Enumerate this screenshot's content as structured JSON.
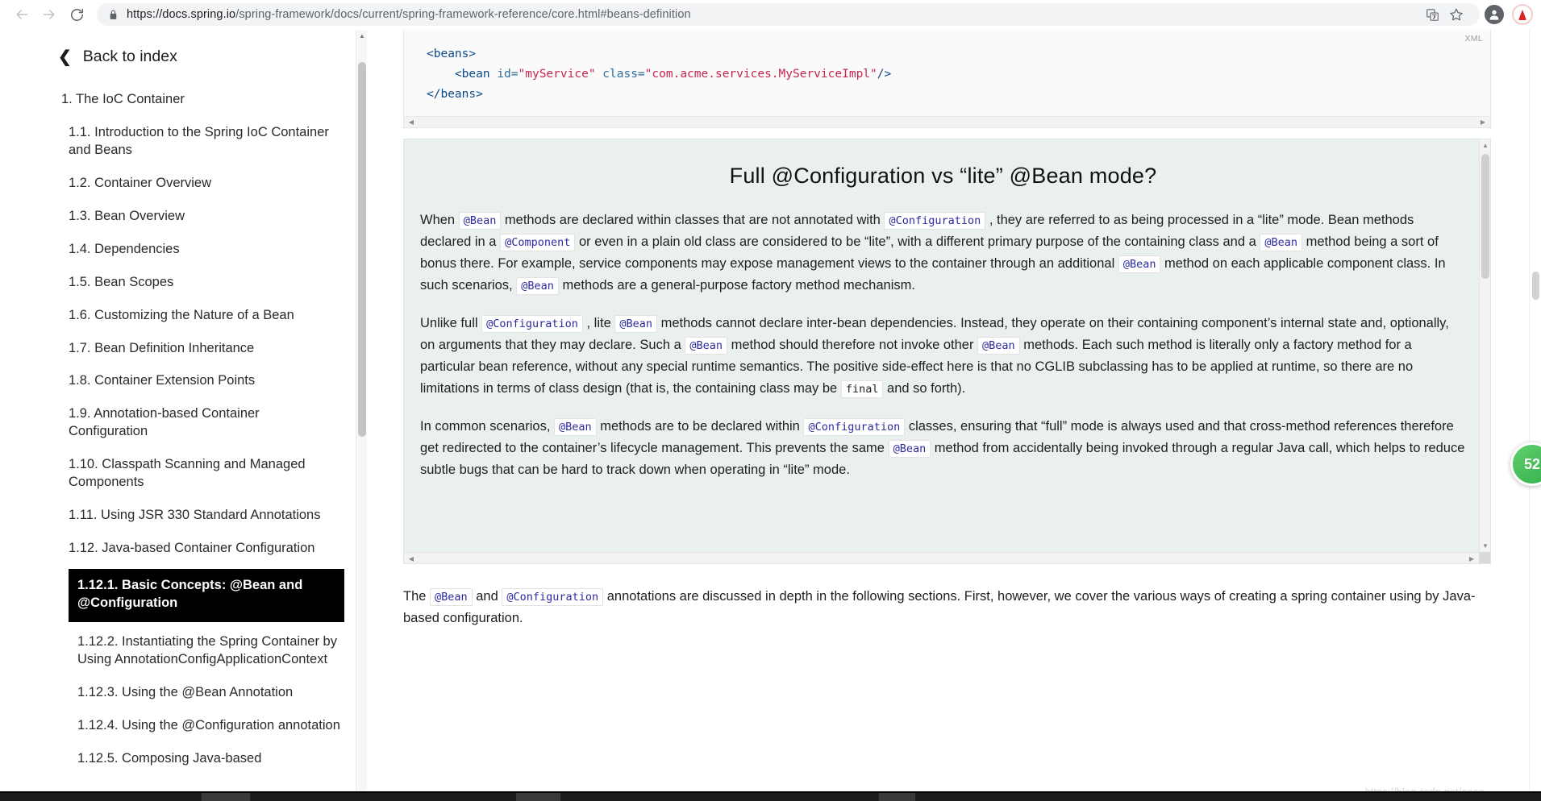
{
  "browser": {
    "back_title": "Back",
    "forward_title": "Forward",
    "reload_title": "Reload",
    "lock_label": "secure-connection",
    "url_prefix": "https://docs.spring.io",
    "url_rest": "/spring-framework/docs/current/spring-framework-reference/core.html#beans-definition",
    "url_full": "https://docs.spring.io/spring-framework/docs/current/spring-framework-reference/core.html#beans-definition",
    "translate_title": "Translate this page",
    "bookmark_title": "Bookmark this tab",
    "profile_title": "Profile",
    "extension_title": "Extension"
  },
  "sidebar": {
    "back_to_index": "Back to index",
    "toc": [
      {
        "label": "1. The IoC Container",
        "level": 1,
        "active": false
      },
      {
        "label": "1.1. Introduction to the Spring IoC Container and Beans",
        "level": 2,
        "active": false
      },
      {
        "label": "1.2. Container Overview",
        "level": 2,
        "active": false
      },
      {
        "label": "1.3. Bean Overview",
        "level": 2,
        "active": false
      },
      {
        "label": "1.4. Dependencies",
        "level": 2,
        "active": false
      },
      {
        "label": "1.5. Bean Scopes",
        "level": 2,
        "active": false
      },
      {
        "label": "1.6. Customizing the Nature of a Bean",
        "level": 2,
        "active": false
      },
      {
        "label": "1.7. Bean Definition Inheritance",
        "level": 2,
        "active": false
      },
      {
        "label": "1.8. Container Extension Points",
        "level": 2,
        "active": false
      },
      {
        "label": "1.9. Annotation-based Container Configuration",
        "level": 2,
        "active": false
      },
      {
        "label": "1.10. Classpath Scanning and Managed Components",
        "level": 2,
        "active": false
      },
      {
        "label": "1.11. Using JSR 330 Standard Annotations",
        "level": 2,
        "active": false
      },
      {
        "label": "1.12. Java-based Container Configuration",
        "level": 2,
        "active": false
      },
      {
        "label": "1.12.1. Basic Concepts: @Bean and @Configuration",
        "level": 3,
        "active": true
      },
      {
        "label": "1.12.2. Instantiating the Spring Container by Using AnnotationConfigApplicationContext",
        "level": 3,
        "active": false
      },
      {
        "label": "1.12.3. Using the @Bean Annotation",
        "level": 3,
        "active": false
      },
      {
        "label": "1.12.4. Using the @Configuration annotation",
        "level": 3,
        "active": false
      },
      {
        "label": "1.12.5. Composing Java-based",
        "level": 3,
        "active": false
      }
    ]
  },
  "content": {
    "code_block": {
      "language_label": "XML",
      "lines": [
        [
          {
            "t": "<beans>",
            "k": "tag"
          }
        ],
        [
          {
            "t": "    ",
            "k": "plain"
          },
          {
            "t": "<bean ",
            "k": "tag"
          },
          {
            "t": "id=",
            "k": "attr"
          },
          {
            "t": "\"myService\"",
            "k": "val"
          },
          {
            "t": " class=",
            "k": "attr"
          },
          {
            "t": "\"com.acme.services.MyServiceImpl\"",
            "k": "val"
          },
          {
            "t": "/>",
            "k": "tag"
          }
        ],
        [
          {
            "t": "</beans>",
            "k": "tag"
          }
        ]
      ]
    },
    "callout": {
      "title": "Full @Configuration vs “lite” @Bean mode?",
      "paragraphs": [
        [
          {
            "t": "When ",
            "k": "text"
          },
          {
            "t": "@Bean",
            "k": "code"
          },
          {
            "t": " methods are declared within classes that are not annotated with ",
            "k": "text"
          },
          {
            "t": "@Configuration",
            "k": "code"
          },
          {
            "t": ", they are referred to as being processed in a “lite” mode. Bean methods declared in a ",
            "k": "text"
          },
          {
            "t": "@Component",
            "k": "code"
          },
          {
            "t": " or even in a plain old class are considered to be “lite”, with a different primary purpose of the containing class and a ",
            "k": "text"
          },
          {
            "t": "@Bean",
            "k": "code"
          },
          {
            "t": " method being a sort of bonus there. For example, service components may expose management views to the container through an additional ",
            "k": "text"
          },
          {
            "t": "@Bean",
            "k": "code"
          },
          {
            "t": " method on each applicable component class. In such scenarios, ",
            "k": "text"
          },
          {
            "t": "@Bean",
            "k": "code"
          },
          {
            "t": " methods are a general-purpose factory method mechanism.",
            "k": "text"
          }
        ],
        [
          {
            "t": "Unlike full ",
            "k": "text"
          },
          {
            "t": "@Configuration",
            "k": "code"
          },
          {
            "t": ", lite ",
            "k": "text"
          },
          {
            "t": "@Bean",
            "k": "code"
          },
          {
            "t": " methods cannot declare inter-bean dependencies. Instead, they operate on their containing component’s internal state and, optionally, on arguments that they may declare. Such a ",
            "k": "text"
          },
          {
            "t": "@Bean",
            "k": "code"
          },
          {
            "t": " method should therefore not invoke other ",
            "k": "text"
          },
          {
            "t": "@Bean",
            "k": "code"
          },
          {
            "t": " methods. Each such method is literally only a factory method for a particular bean reference, without any special runtime semantics. The positive side-effect here is that no CGLIB subclassing has to be applied at runtime, so there are no limitations in terms of class design (that is, the containing class may be ",
            "k": "text"
          },
          {
            "t": "final",
            "k": "code-plain"
          },
          {
            "t": " and so forth).",
            "k": "text"
          }
        ],
        [
          {
            "t": "In common scenarios, ",
            "k": "text"
          },
          {
            "t": "@Bean",
            "k": "code"
          },
          {
            "t": " methods are to be declared within ",
            "k": "text"
          },
          {
            "t": "@Configuration",
            "k": "code"
          },
          {
            "t": " classes, ensuring that “full” mode is always used and that cross-method references therefore get redirected to the container’s lifecycle management. This prevents the same ",
            "k": "text"
          },
          {
            "t": "@Bean",
            "k": "code"
          },
          {
            "t": " method from accidentally being invoked through a regular Java call, which helps to reduce subtle bugs that can be hard to track down when operating in “lite” mode.",
            "k": "text"
          }
        ]
      ]
    },
    "trailing_paragraph": [
      {
        "t": "The ",
        "k": "text"
      },
      {
        "t": "@Bean",
        "k": "code"
      },
      {
        "t": " and ",
        "k": "text"
      },
      {
        "t": "@Configuration",
        "k": "code"
      },
      {
        "t": " annotations are discussed in depth in the following sections. First, however, we cover the various ways of creating a spring container using by Java-based configuration.",
        "k": "text"
      }
    ]
  },
  "overlays": {
    "float_badge_count": "52",
    "watermark": "https://blog.csdn.net/aaaa"
  },
  "colors": {
    "accent_active_bg": "#000000",
    "callout_bg": "#e9f0ee",
    "inline_code_fg": "#2b2b9e",
    "xml_tag": "#0b4a8a",
    "xml_value": "#c7254e",
    "badge_green": "#37b24d"
  }
}
